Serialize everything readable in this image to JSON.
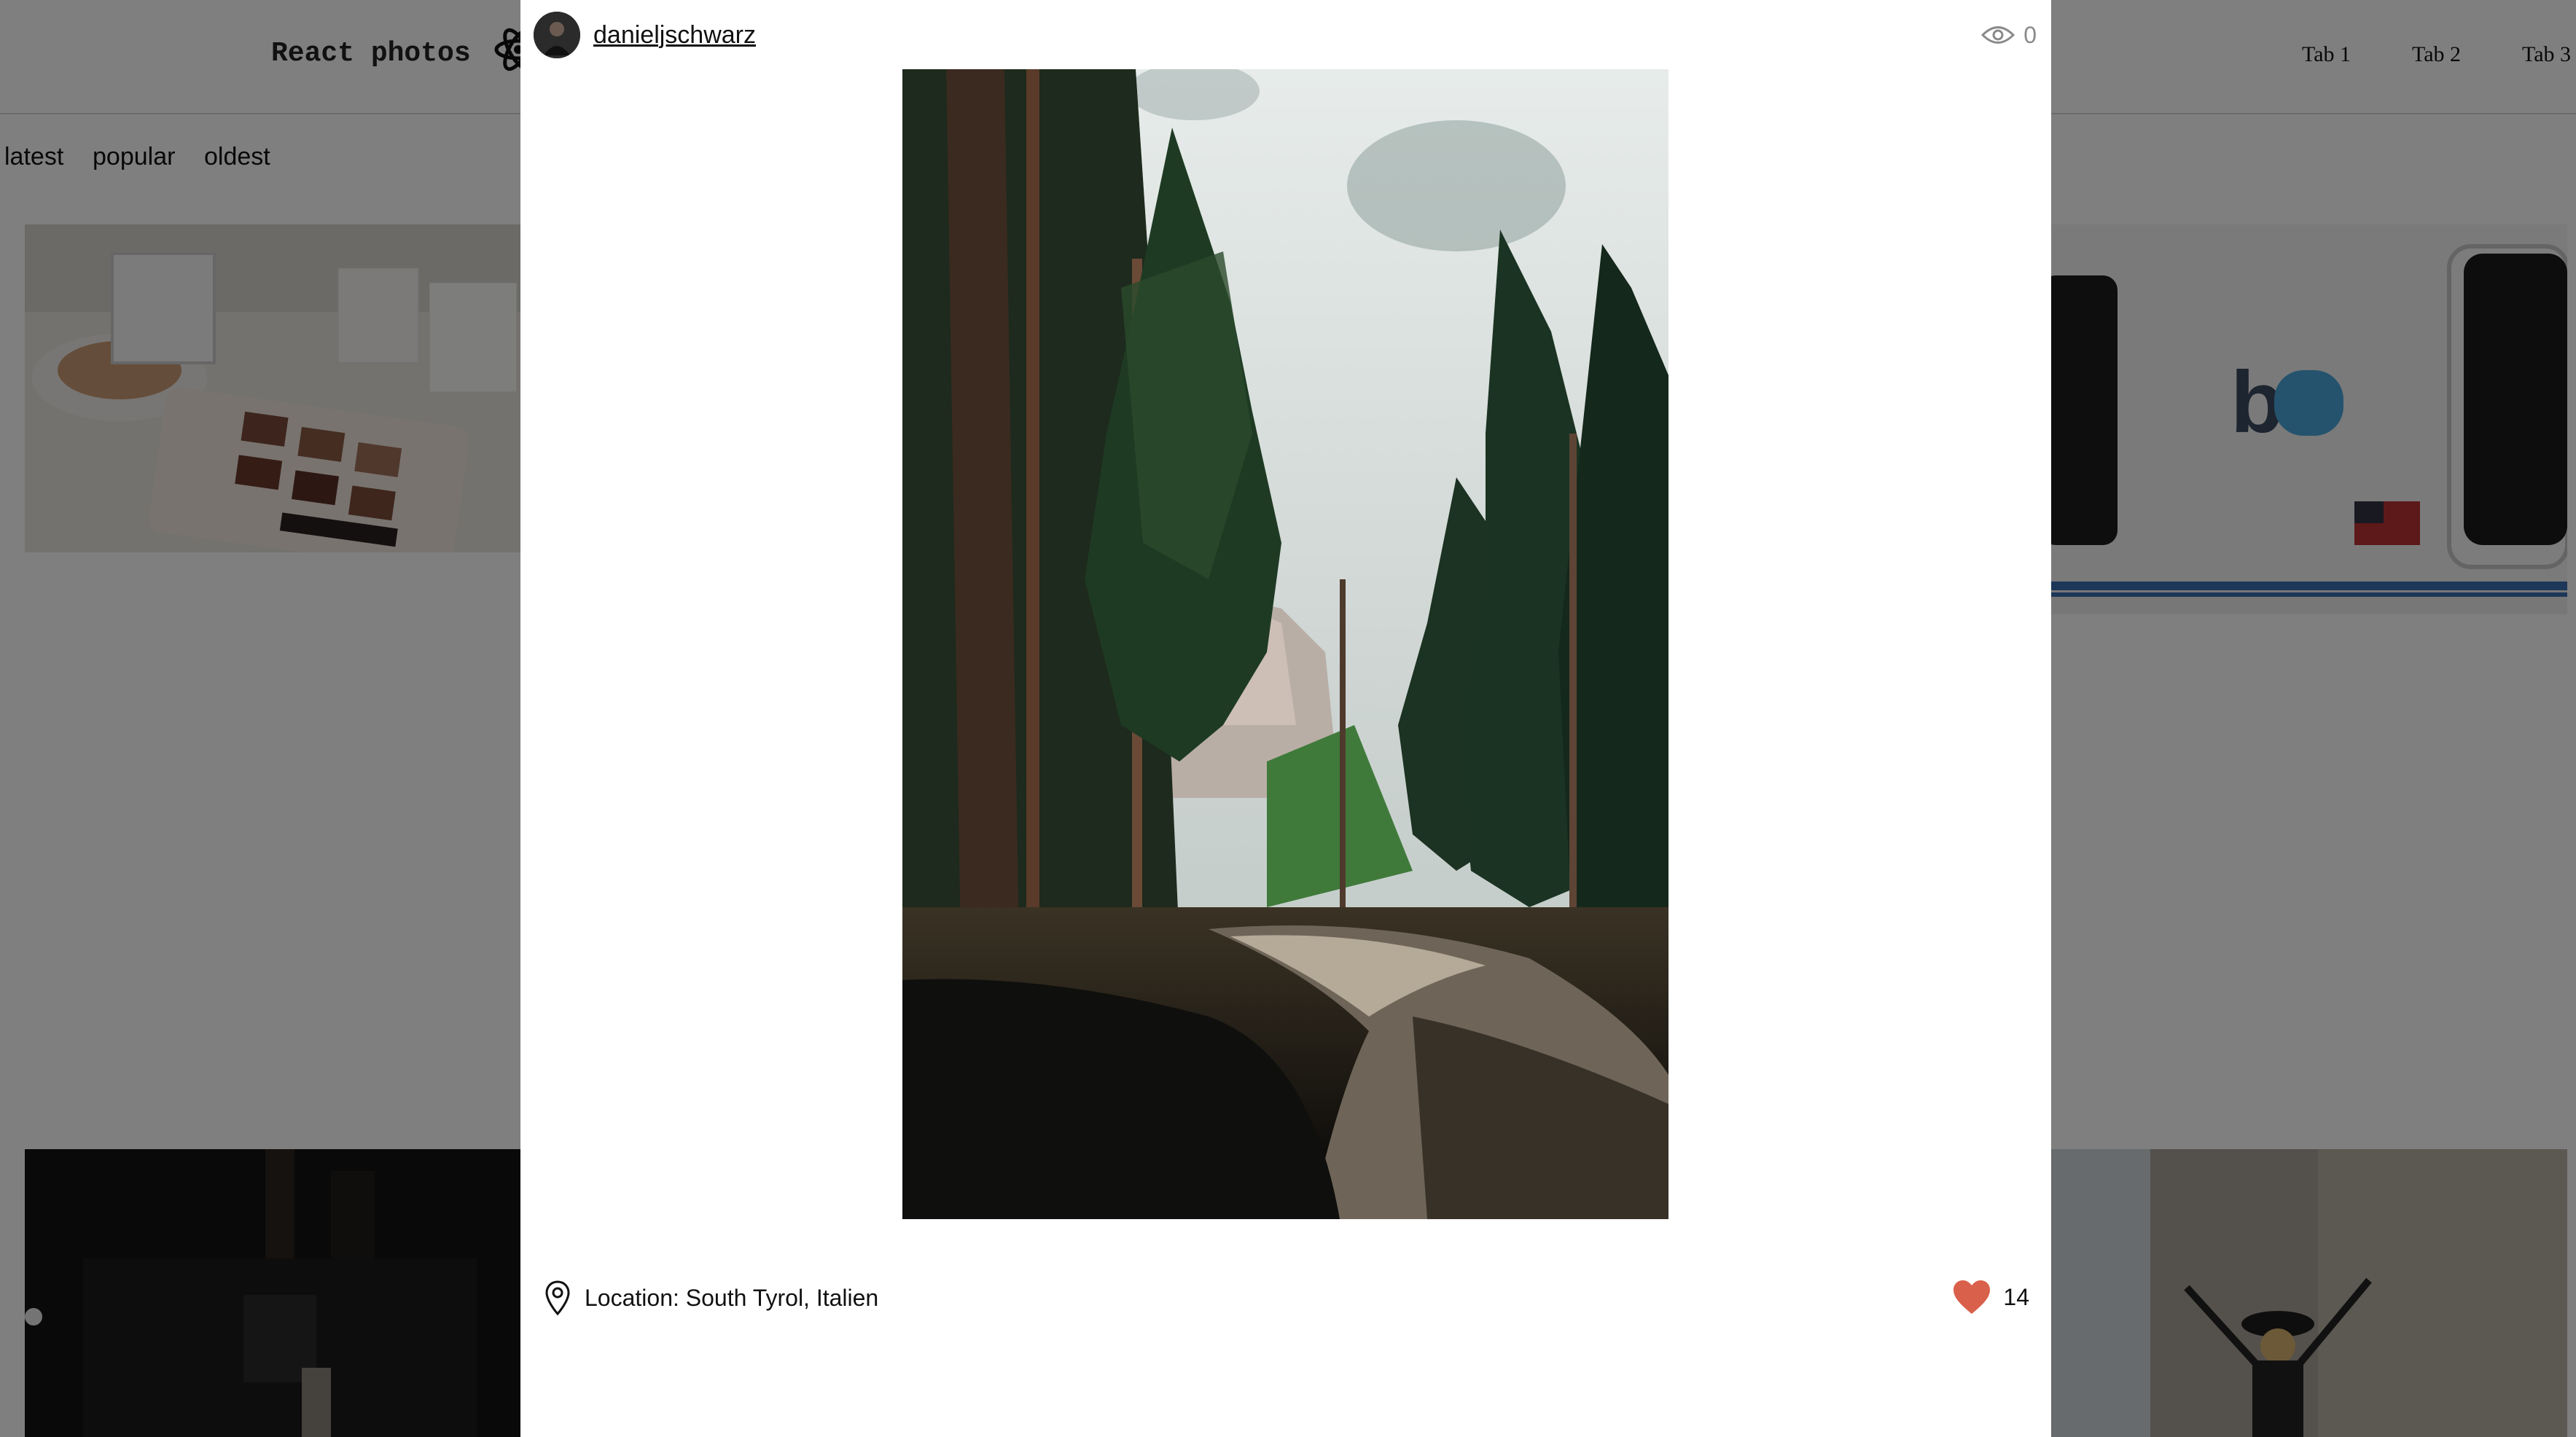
{
  "app": {
    "title": "React photos",
    "tabs": [
      "Tab 1",
      "Tab 2",
      "Tab 3"
    ]
  },
  "sort": {
    "options": [
      "latest",
      "popular",
      "oldest"
    ]
  },
  "modal": {
    "username": "danieljschwarz",
    "views": "0",
    "location": "Location: South Tyrol, Italien",
    "likes": "14"
  },
  "colors": {
    "heart": "#d9604a",
    "overlay": "rgba(0,0,0,0.5)",
    "views_text": "#8a8a8a"
  },
  "icons": {
    "views": "eye-icon",
    "location": "map-pin-icon",
    "likes": "heart-icon"
  }
}
